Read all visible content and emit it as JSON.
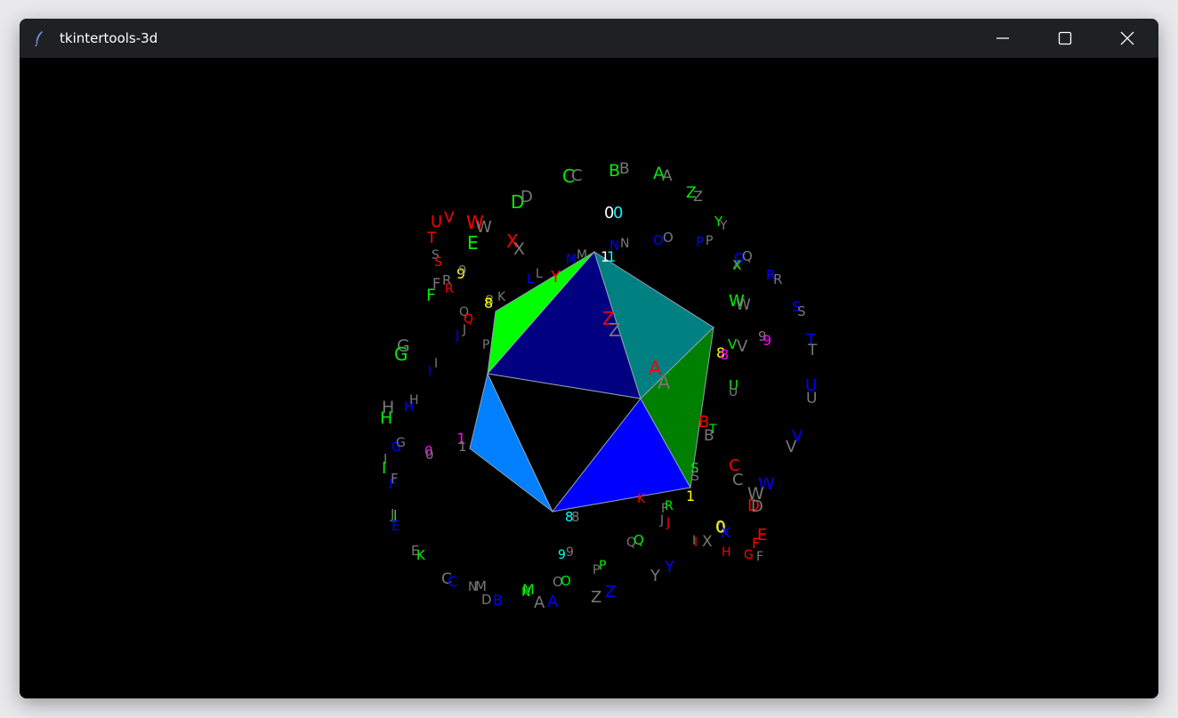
{
  "window": {
    "title": "tkintertools-3d"
  },
  "titlebar_icons": {
    "app": "feather-icon",
    "minimize": "minimize-icon",
    "maximize": "maximize-icon",
    "close": "close-icon"
  },
  "colors": {
    "background": "#000000",
    "titlebar": "#1f2024",
    "faces": [
      "#00ff00",
      "#000080",
      "#008080",
      "#007fff",
      "#000000",
      "#0000ff",
      "#008000"
    ],
    "label_palette": [
      "#ff0000",
      "#00ee00",
      "#0000ff",
      "#777777",
      "#ffff00",
      "#ff00ff",
      "#00ffff",
      "#ffffff"
    ]
  },
  "labels": [
    {
      "t": "C",
      "c": "#00ee00"
    },
    {
      "t": "C",
      "c": "#777777"
    },
    {
      "t": "B",
      "c": "#00ee00"
    },
    {
      "t": "B",
      "c": "#777777"
    },
    {
      "t": "A",
      "c": "#00ee00"
    },
    {
      "t": "A",
      "c": "#777777"
    },
    {
      "t": "Z",
      "c": "#00ee00"
    },
    {
      "t": "Z",
      "c": "#777777"
    },
    {
      "t": "Y",
      "c": "#00ee00"
    },
    {
      "t": "Y",
      "c": "#777777"
    },
    {
      "t": "D",
      "c": "#00ee00"
    },
    {
      "t": "D",
      "c": "#777777"
    },
    {
      "t": "0",
      "c": "#ffffff"
    },
    {
      "t": "0",
      "c": "#00ffff"
    },
    {
      "t": "U",
      "c": "#ff0000"
    },
    {
      "t": "V",
      "c": "#ff0000"
    },
    {
      "t": "W",
      "c": "#ff0000"
    },
    {
      "t": "W",
      "c": "#777777"
    },
    {
      "t": "T",
      "c": "#ff0000"
    },
    {
      "t": "E",
      "c": "#00ee00"
    },
    {
      "t": "X",
      "c": "#ff0000"
    },
    {
      "t": "X",
      "c": "#777777"
    },
    {
      "t": "N",
      "c": "#0000ff"
    },
    {
      "t": "N",
      "c": "#777777"
    },
    {
      "t": "O",
      "c": "#0000ff"
    },
    {
      "t": "O",
      "c": "#777777"
    },
    {
      "t": "P",
      "c": "#0000ff"
    },
    {
      "t": "P",
      "c": "#777777"
    },
    {
      "t": "Q",
      "c": "#0000ff"
    },
    {
      "t": "Q",
      "c": "#777777"
    },
    {
      "t": "X",
      "c": "#00ee00"
    },
    {
      "t": "X",
      "c": "#777777"
    },
    {
      "t": "S",
      "c": "#777777"
    },
    {
      "t": "S",
      "c": "#ff0000"
    },
    {
      "t": "M",
      "c": "#0000ff"
    },
    {
      "t": "M",
      "c": "#777777"
    },
    {
      "t": "1",
      "c": "#ffffff"
    },
    {
      "t": "1",
      "c": "#00ffff"
    },
    {
      "t": "9",
      "c": "#ffff00"
    },
    {
      "t": "9",
      "c": "#777777"
    },
    {
      "t": "L",
      "c": "#0000ff"
    },
    {
      "t": "L",
      "c": "#777777"
    },
    {
      "t": "Y",
      "c": "#ff0000"
    },
    {
      "t": "F",
      "c": "#777777"
    },
    {
      "t": "R",
      "c": "#777777"
    },
    {
      "t": "R",
      "c": "#ff0000"
    },
    {
      "t": "F",
      "c": "#00ee00"
    },
    {
      "t": "8",
      "c": "#777777"
    },
    {
      "t": "8",
      "c": "#ffff00"
    },
    {
      "t": "K",
      "c": "#777777"
    },
    {
      "t": "R",
      "c": "#0000ff"
    },
    {
      "t": "R",
      "c": "#777777"
    },
    {
      "t": "W",
      "c": "#00ee00"
    },
    {
      "t": "W",
      "c": "#777777"
    },
    {
      "t": "S",
      "c": "#0000ff"
    },
    {
      "t": "S",
      "c": "#777777"
    },
    {
      "t": "Q",
      "c": "#777777"
    },
    {
      "t": "Q",
      "c": "#ff0000"
    },
    {
      "t": "J",
      "c": "#0000ff"
    },
    {
      "t": "J",
      "c": "#777777"
    },
    {
      "t": "Z",
      "c": "#ff0000"
    },
    {
      "t": "Z",
      "c": "#777777"
    },
    {
      "t": "G",
      "c": "#777777"
    },
    {
      "t": "G",
      "c": "#00ee00"
    },
    {
      "t": "P",
      "c": "#777777"
    },
    {
      "t": "9",
      "c": "#777777"
    },
    {
      "t": "9",
      "c": "#ff00ff"
    },
    {
      "t": "8",
      "c": "#ffff00"
    },
    {
      "t": "8",
      "c": "#ff00ff"
    },
    {
      "t": "V",
      "c": "#00ee00"
    },
    {
      "t": "V",
      "c": "#777777"
    },
    {
      "t": "T",
      "c": "#0000ff"
    },
    {
      "t": "T",
      "c": "#777777"
    },
    {
      "t": "I",
      "c": "#0000ff"
    },
    {
      "t": "I",
      "c": "#777777"
    },
    {
      "t": "A",
      "c": "#ff0000"
    },
    {
      "t": "A",
      "c": "#777777"
    },
    {
      "t": "U",
      "c": "#00ee00"
    },
    {
      "t": "U",
      "c": "#777777"
    },
    {
      "t": "U",
      "c": "#0000ff"
    },
    {
      "t": "U",
      "c": "#777777"
    },
    {
      "t": "H",
      "c": "#777777"
    },
    {
      "t": "H",
      "c": "#00ee00"
    },
    {
      "t": "H",
      "c": "#0000ff"
    },
    {
      "t": "H",
      "c": "#777777"
    },
    {
      "t": "B",
      "c": "#ff0000"
    },
    {
      "t": "B",
      "c": "#777777"
    },
    {
      "t": "T",
      "c": "#00ee00"
    },
    {
      "t": "V",
      "c": "#0000ff"
    },
    {
      "t": "V",
      "c": "#777777"
    },
    {
      "t": "G",
      "c": "#0000ff"
    },
    {
      "t": "G",
      "c": "#777777"
    },
    {
      "t": "0",
      "c": "#ff00ff"
    },
    {
      "t": "0",
      "c": "#777777"
    },
    {
      "t": "1",
      "c": "#ff00ff"
    },
    {
      "t": "1",
      "c": "#777777"
    },
    {
      "t": "S",
      "c": "#00ee00"
    },
    {
      "t": "S",
      "c": "#777777"
    },
    {
      "t": "C",
      "c": "#ff0000"
    },
    {
      "t": "C",
      "c": "#777777"
    },
    {
      "t": "W",
      "c": "#0000ff"
    },
    {
      "t": "W",
      "c": "#777777"
    },
    {
      "t": "I",
      "c": "#00ee00"
    },
    {
      "t": "I",
      "c": "#777777"
    },
    {
      "t": "F",
      "c": "#0000ff"
    },
    {
      "t": "F",
      "c": "#777777"
    },
    {
      "t": "1",
      "c": "#ffff00"
    },
    {
      "t": "D",
      "c": "#ff0000"
    },
    {
      "t": "D",
      "c": "#777777"
    },
    {
      "t": "K",
      "c": "#ff0000"
    },
    {
      "t": "F",
      "c": "#777777"
    },
    {
      "t": "R",
      "c": "#00ee00"
    },
    {
      "t": "J",
      "c": "#777777"
    },
    {
      "t": "J",
      "c": "#ff0000"
    },
    {
      "t": "J",
      "c": "#777777"
    },
    {
      "t": "J",
      "c": "#00ee00"
    },
    {
      "t": "E",
      "c": "#0000ff"
    },
    {
      "t": "8",
      "c": "#00ffff"
    },
    {
      "t": "8",
      "c": "#777777"
    },
    {
      "t": "0",
      "c": "#777777"
    },
    {
      "t": "0",
      "c": "#ffff00"
    },
    {
      "t": "X",
      "c": "#0000ff"
    },
    {
      "t": "E",
      "c": "#ff0000"
    },
    {
      "t": "F",
      "c": "#ff0000"
    },
    {
      "t": "Q",
      "c": "#777777"
    },
    {
      "t": "Q",
      "c": "#00ee00"
    },
    {
      "t": "I",
      "c": "#777777"
    },
    {
      "t": "I",
      "c": "#ff0000"
    },
    {
      "t": "X",
      "c": "#777777"
    },
    {
      "t": "H",
      "c": "#ff0000"
    },
    {
      "t": "G",
      "c": "#ff0000"
    },
    {
      "t": "F",
      "c": "#777777"
    },
    {
      "t": "9",
      "c": "#00ffff"
    },
    {
      "t": "9",
      "c": "#777777"
    },
    {
      "t": "P",
      "c": "#777777"
    },
    {
      "t": "P",
      "c": "#00ee00"
    },
    {
      "t": "Y",
      "c": "#777777"
    },
    {
      "t": "Y",
      "c": "#0000ff"
    },
    {
      "t": "E",
      "c": "#777777"
    },
    {
      "t": "K",
      "c": "#00ee00"
    },
    {
      "t": "C",
      "c": "#777777"
    },
    {
      "t": "C",
      "c": "#0000ff"
    },
    {
      "t": "O",
      "c": "#777777"
    },
    {
      "t": "O",
      "c": "#00ee00"
    },
    {
      "t": "Z",
      "c": "#777777"
    },
    {
      "t": "Z",
      "c": "#0000ff"
    },
    {
      "t": "N",
      "c": "#777777"
    },
    {
      "t": "N",
      "c": "#00ee00"
    },
    {
      "t": "M",
      "c": "#777777"
    },
    {
      "t": "M",
      "c": "#00ee00"
    },
    {
      "t": "D",
      "c": "#777777"
    },
    {
      "t": "B",
      "c": "#0000ff"
    },
    {
      "t": "A",
      "c": "#777777"
    },
    {
      "t": "A",
      "c": "#0000ff"
    }
  ]
}
